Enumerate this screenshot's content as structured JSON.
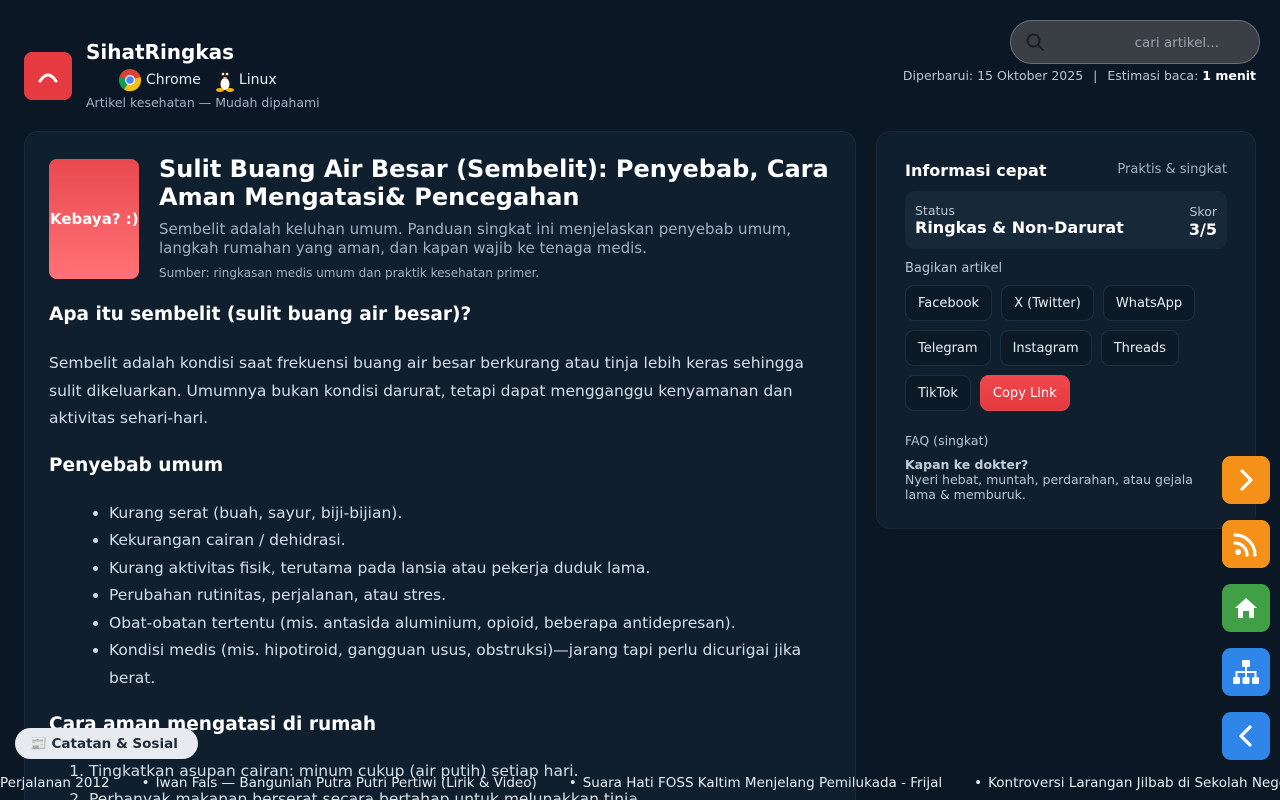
{
  "header": {
    "brand_name": "SihatRingkas",
    "tagline": "Artikel kesehatan — Mudah dipahami",
    "platforms": [
      {
        "label": "Chrome",
        "icon": "chrome-icon"
      },
      {
        "label": "Linux",
        "icon": "linux-icon"
      }
    ],
    "search_placeholder": "cari artikel...",
    "updated_label": "Diperbarui: 15 Oktober 2025",
    "separator": "|",
    "read_label": "Estimasi baca:",
    "read_value": "1 menit"
  },
  "article": {
    "thumb_text": "Kebaya? :)",
    "title": "Sulit Buang Air Besar (Sembelit): Penyebab, Cara Aman Mengatasi& Pencegahan",
    "lead": "Sembelit adalah keluhan umum. Panduan singkat ini menjelaskan penyebab umum, langkah rumahan yang aman, dan kapan wajib ke tenaga medis.",
    "source": "Sumber: ringkasan medis umum dan praktik kesehatan primer.",
    "section1_heading": "Apa itu sembelit (sulit buang air besar)?",
    "section1_text": "Sembelit adalah kondisi saat frekuensi buang air besar berkurang atau tinja lebih keras sehingga sulit dikeluarkan. Umumnya bukan kondisi darurat, tetapi dapat mengganggu kenyamanan dan aktivitas sehari-hari.",
    "section2_heading": "Penyebab umum",
    "causes": [
      "Kurang serat (buah, sayur, biji-bijian).",
      "Kekurangan cairan / dehidrasi.",
      "Kurang aktivitas fisik, terutama pada lansia atau pekerja duduk lama.",
      "Perubahan rutinitas, perjalanan, atau stres.",
      "Obat-obatan tertentu (mis. antasida aluminium, opioid, beberapa antidepresan).",
      "Kondisi medis (mis. hipotiroid, gangguan usus, obstruksi)—jarang tapi perlu dicurigai jika berat."
    ],
    "section3_heading": "Cara aman mengatasi di rumah",
    "remedies": [
      "Tingkatkan asupan cairan: minum cukup (air putih) setiap hari.",
      "Perbanyak makanan berserat secara bertahap untuk melunakkan tinja."
    ]
  },
  "sidebar": {
    "title": "Informasi cepat",
    "subtitle": "Praktis & singkat",
    "status_label": "Status",
    "status_value": "Ringkas & Non-Darurat",
    "score_label": "Skor",
    "score_value": "3/5",
    "share_label": "Bagikan artikel",
    "share_buttons": [
      "Facebook",
      "X (Twitter)",
      "WhatsApp",
      "Telegram",
      "Instagram",
      "Threads",
      "TikTok",
      "Copy Link"
    ],
    "faq_label": "FAQ (singkat)",
    "faq_question": "Kapan ke dokter?",
    "faq_answer": "Nyeri hebat, muntah, perdarahan, atau gejala lama & memburuk."
  },
  "fabs": [
    "chevron-right-icon",
    "rss-icon",
    "home-icon",
    "sitemap-icon",
    "chevron-left-icon"
  ],
  "bottom": {
    "notes_label": "📰 Catatan & Sosial",
    "ticker": [
      "Perjalanan 2012",
      "Iwan Fals — Bangunlah Putra Putri Pertiwi (Lirik & Video)",
      "Suara Hati FOSS Kaltim Menjelang Pemilukada - Frijal",
      "Kontroversi Larangan Jilbab di Sekolah Negeri"
    ]
  },
  "colors": {
    "background": "#0b1724",
    "card": "#0f1f2e",
    "accent_red": "#e8494f",
    "fab_orange": "#f59019",
    "fab_green": "#3fa045",
    "fab_blue": "#2f86e8"
  }
}
